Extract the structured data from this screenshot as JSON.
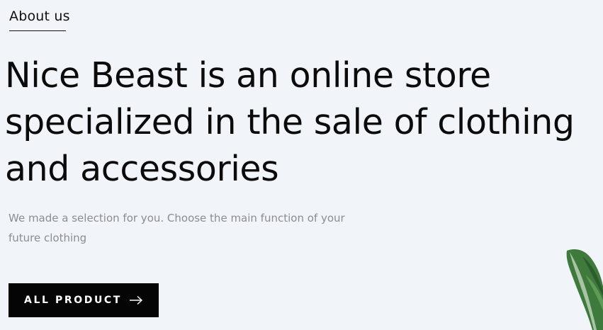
{
  "section": {
    "tab_label": "About us"
  },
  "hero": {
    "headline_lines": [
      "Nice Beast is an online store",
      "specialized in the sale of clothing",
      "and accessories"
    ],
    "subtext_lines": [
      "We made a selection for you. Choose the main function of your",
      "future clothing"
    ],
    "cta_label": "ALL PRODUCT",
    "cta_icon": "arrow-right-icon"
  },
  "decoration": {
    "image": "leaf-plant-image"
  },
  "colors": {
    "background": "#f1f4f9",
    "text": "#0b0b0b",
    "muted": "#8a8d93",
    "button_bg": "#050505",
    "button_text": "#ffffff",
    "leaf_green": "#3e7a3c"
  }
}
